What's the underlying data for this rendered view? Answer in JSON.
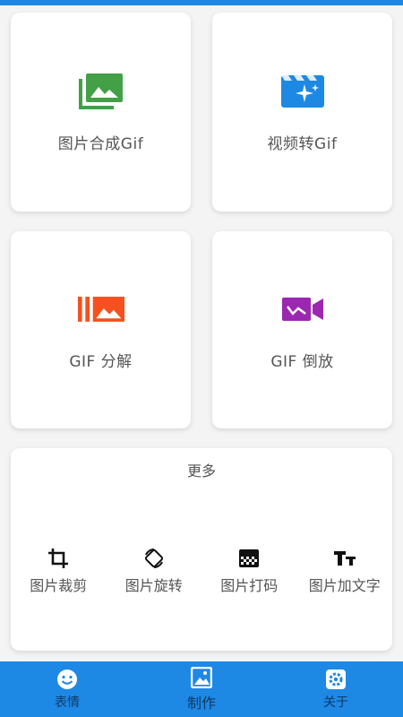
{
  "tools": [
    {
      "label": "图片合成Gif",
      "icon": "images-icon",
      "color": "#43a047"
    },
    {
      "label": "视频转Gif",
      "icon": "video-sparkle-icon",
      "color": "#1e88e5"
    },
    {
      "label": "GIF 分解",
      "icon": "split-image-icon",
      "color": "#f4511e"
    },
    {
      "label": "GIF 倒放",
      "icon": "video-camera-icon",
      "color": "#9c27b0"
    }
  ],
  "more": {
    "title": "更多",
    "items": [
      {
        "label": "图片裁剪",
        "icon": "crop-icon"
      },
      {
        "label": "图片旋转",
        "icon": "rotate-icon"
      },
      {
        "label": "图片打码",
        "icon": "mosaic-icon"
      },
      {
        "label": "图片加文字",
        "icon": "text-icon"
      }
    ]
  },
  "nav": {
    "items": [
      {
        "label": "表情",
        "icon": "smiley-icon"
      },
      {
        "label": "制作",
        "icon": "image-icon",
        "active": true
      },
      {
        "label": "关于",
        "icon": "settings-icon"
      }
    ]
  },
  "colors": {
    "primary": "#1e88e5",
    "background": "#f4f4f4"
  }
}
